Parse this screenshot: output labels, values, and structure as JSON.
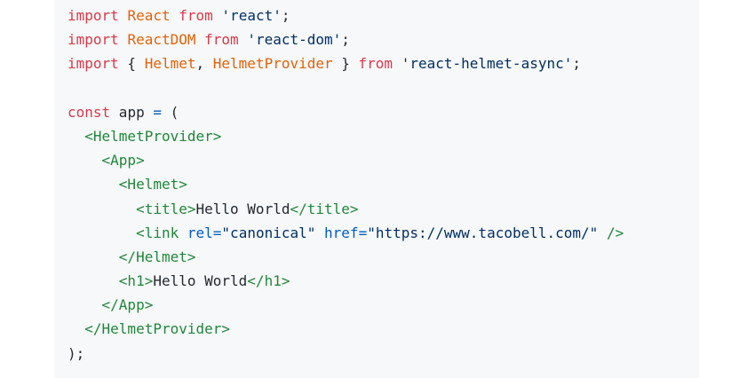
{
  "code": {
    "language": "jsx",
    "lines": [
      [
        {
          "t": "import",
          "c": "kw"
        },
        {
          "t": " ",
          "c": "txt"
        },
        {
          "t": "React",
          "c": "id"
        },
        {
          "t": " ",
          "c": "txt"
        },
        {
          "t": "from",
          "c": "kw"
        },
        {
          "t": " ",
          "c": "txt"
        },
        {
          "t": "'react'",
          "c": "str"
        },
        {
          "t": ";",
          "c": "txt"
        }
      ],
      [
        {
          "t": "import",
          "c": "kw"
        },
        {
          "t": " ",
          "c": "txt"
        },
        {
          "t": "ReactDOM",
          "c": "id"
        },
        {
          "t": " ",
          "c": "txt"
        },
        {
          "t": "from",
          "c": "kw"
        },
        {
          "t": " ",
          "c": "txt"
        },
        {
          "t": "'react-dom'",
          "c": "str"
        },
        {
          "t": ";",
          "c": "txt"
        }
      ],
      [
        {
          "t": "import",
          "c": "kw"
        },
        {
          "t": " { ",
          "c": "txt"
        },
        {
          "t": "Helmet",
          "c": "id"
        },
        {
          "t": ", ",
          "c": "txt"
        },
        {
          "t": "HelmetProvider",
          "c": "id"
        },
        {
          "t": " } ",
          "c": "txt"
        },
        {
          "t": "from",
          "c": "kw"
        },
        {
          "t": " ",
          "c": "txt"
        },
        {
          "t": "'react-helmet-async'",
          "c": "str"
        },
        {
          "t": ";",
          "c": "txt"
        }
      ],
      [],
      [
        {
          "t": "const",
          "c": "kw"
        },
        {
          "t": " app ",
          "c": "txt"
        },
        {
          "t": "=",
          "c": "attr"
        },
        {
          "t": " (",
          "c": "txt"
        }
      ],
      [
        {
          "t": "  ",
          "c": "txt"
        },
        {
          "t": "<HelmetProvider>",
          "c": "tag"
        }
      ],
      [
        {
          "t": "    ",
          "c": "txt"
        },
        {
          "t": "<App>",
          "c": "tag"
        }
      ],
      [
        {
          "t": "      ",
          "c": "txt"
        },
        {
          "t": "<Helmet>",
          "c": "tag"
        }
      ],
      [
        {
          "t": "        ",
          "c": "txt"
        },
        {
          "t": "<title>",
          "c": "tag"
        },
        {
          "t": "Hello World",
          "c": "txt"
        },
        {
          "t": "</title>",
          "c": "tag"
        }
      ],
      [
        {
          "t": "        ",
          "c": "txt"
        },
        {
          "t": "<link",
          "c": "tag"
        },
        {
          "t": " ",
          "c": "txt"
        },
        {
          "t": "rel",
          "c": "attr"
        },
        {
          "t": "=",
          "c": "attr"
        },
        {
          "t": "\"canonical\"",
          "c": "str"
        },
        {
          "t": " ",
          "c": "txt"
        },
        {
          "t": "href",
          "c": "attr"
        },
        {
          "t": "=",
          "c": "attr"
        },
        {
          "t": "\"https://www.tacobell.com/\"",
          "c": "str"
        },
        {
          "t": " ",
          "c": "txt"
        },
        {
          "t": "/>",
          "c": "tag"
        }
      ],
      [
        {
          "t": "      ",
          "c": "txt"
        },
        {
          "t": "</Helmet>",
          "c": "tag"
        }
      ],
      [
        {
          "t": "      ",
          "c": "txt"
        },
        {
          "t": "<h1>",
          "c": "tag"
        },
        {
          "t": "Hello World",
          "c": "txt"
        },
        {
          "t": "</h1>",
          "c": "tag"
        }
      ],
      [
        {
          "t": "    ",
          "c": "txt"
        },
        {
          "t": "</App>",
          "c": "tag"
        }
      ],
      [
        {
          "t": "  ",
          "c": "txt"
        },
        {
          "t": "</HelmetProvider>",
          "c": "tag"
        }
      ],
      [
        {
          "t": ");",
          "c": "txt"
        }
      ]
    ]
  }
}
